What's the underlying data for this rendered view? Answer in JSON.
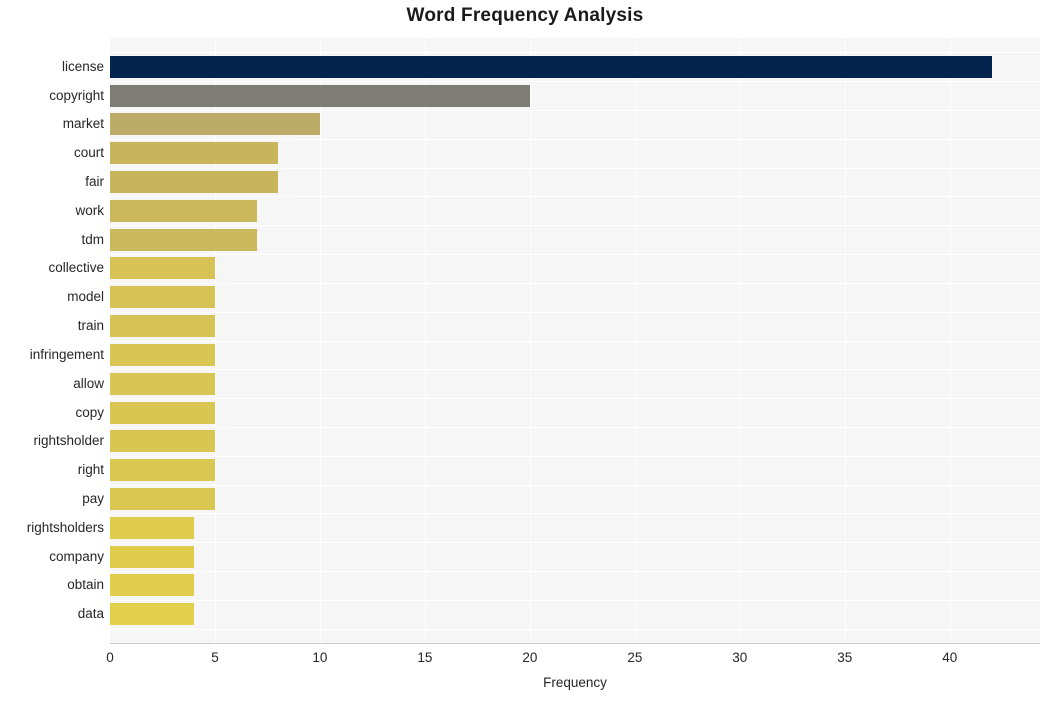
{
  "chart_data": {
    "type": "bar",
    "orientation": "horizontal",
    "title": "Word Frequency Analysis",
    "xlabel": "Frequency",
    "ylabel": "",
    "xlim": [
      0,
      44.3
    ],
    "xticks": [
      0,
      5,
      10,
      15,
      20,
      25,
      30,
      35,
      40
    ],
    "grid": true,
    "legend": null,
    "categories": [
      "license",
      "copyright",
      "market",
      "court",
      "fair",
      "work",
      "tdm",
      "collective",
      "model",
      "train",
      "infringement",
      "allow",
      "copy",
      "rightsholder",
      "right",
      "pay",
      "rightsholders",
      "company",
      "obtain",
      "data"
    ],
    "values": [
      42,
      20,
      10,
      8,
      8,
      7,
      7,
      5,
      5,
      5,
      5,
      5,
      5,
      5,
      5,
      5,
      4,
      4,
      4,
      4
    ],
    "bar_colors": [
      "#04234f",
      "#7d7d76",
      "#bdab68",
      "#c9b45e",
      "#c9b45e",
      "#ccb85c",
      "#ccb85c",
      "#d6c255",
      "#d6c255",
      "#d6c255",
      "#d8c553",
      "#d8c553",
      "#d9c652",
      "#d9c652",
      "#dac751",
      "#dac751",
      "#dfcc4d",
      "#dfcc4d",
      "#e0cd4c",
      "#e2cf4b"
    ],
    "plot_bg": "#f6f6f6",
    "grid_color": "#ffffff",
    "text_color": "#262626"
  },
  "axis": {
    "x_tick_labels": [
      "0",
      "5",
      "10",
      "15",
      "20",
      "25",
      "30",
      "35",
      "40"
    ],
    "x_title": "Frequency"
  }
}
